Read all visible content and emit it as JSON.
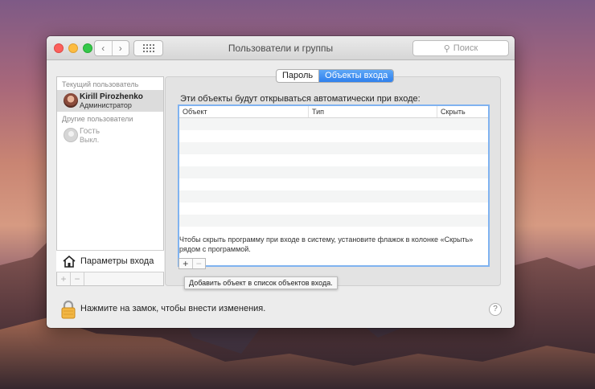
{
  "window": {
    "title": "Пользователи и группы",
    "search_placeholder": "Поиск"
  },
  "sidebar": {
    "current_user_section": "Текущий пользователь",
    "current_user": {
      "name": "Kirill Pirozhenko",
      "role": "Администратор"
    },
    "other_users_section": "Другие пользователи",
    "guest_user": {
      "name": "Гость",
      "status": "Выкл."
    },
    "login_options_label": "Параметры входа"
  },
  "tabs": [
    {
      "label": "Пароль",
      "active": false
    },
    {
      "label": "Объекты входа",
      "active": true
    }
  ],
  "login_items": {
    "title": "Эти объекты будут открываться автоматически при входе:",
    "columns": [
      "Объект",
      "Тип",
      "Скрыть"
    ],
    "rows": [],
    "hint": "Чтобы скрыть программу при входе в систему, установите флажок в колонке «Скрыть» рядом с программой.",
    "tooltip": "Добавить объект в список объектов входа."
  },
  "footer": {
    "lock_text": "Нажмите на замок, чтобы внести изменения."
  },
  "icons": {
    "close": "close-icon",
    "minimize": "minimize-icon",
    "zoom": "zoom-icon",
    "back": "chevron-left-icon",
    "forward": "chevron-right-icon",
    "show_all": "grid-icon",
    "search": "search-icon",
    "login_options": "house-icon",
    "lock": "lock-icon",
    "help": "help-icon"
  },
  "colors": {
    "selected_tab": "#2f80ed",
    "table_focus_border": "#80b3f0",
    "traffic_close": "#fc605c",
    "traffic_minimize": "#fdbc40",
    "traffic_zoom": "#34c84a"
  }
}
